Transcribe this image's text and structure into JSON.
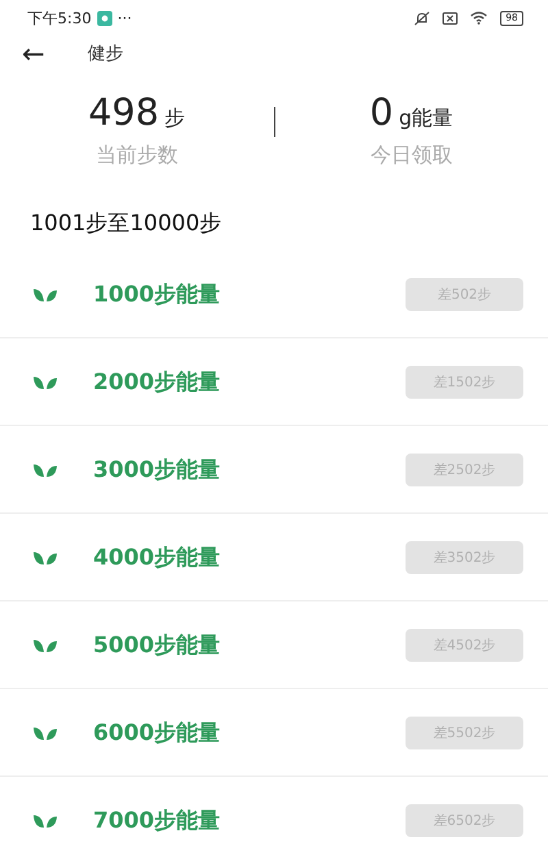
{
  "status_bar": {
    "time": "下午5:30",
    "dots": "···",
    "battery": "98"
  },
  "header": {
    "back": "←",
    "title": "健步"
  },
  "stats": [
    {
      "value": "498",
      "unit": "步",
      "label": "当前步数"
    },
    {
      "value": "0",
      "unit": "g能量",
      "label": "今日领取"
    }
  ],
  "section_title": "1001步至10000步",
  "rewards": [
    {
      "title": "1000步能量",
      "button": "差502步",
      "disabled": true
    },
    {
      "title": "2000步能量",
      "button": "差1502步",
      "disabled": true
    },
    {
      "title": "3000步能量",
      "button": "差2502步",
      "disabled": true
    },
    {
      "title": "4000步能量",
      "button": "差3502步",
      "disabled": true
    },
    {
      "title": "5000步能量",
      "button": "差4502步",
      "disabled": true
    },
    {
      "title": "6000步能量",
      "button": "差5502步",
      "disabled": true
    },
    {
      "title": "7000步能量",
      "button": "差6502步",
      "disabled": true
    }
  ]
}
